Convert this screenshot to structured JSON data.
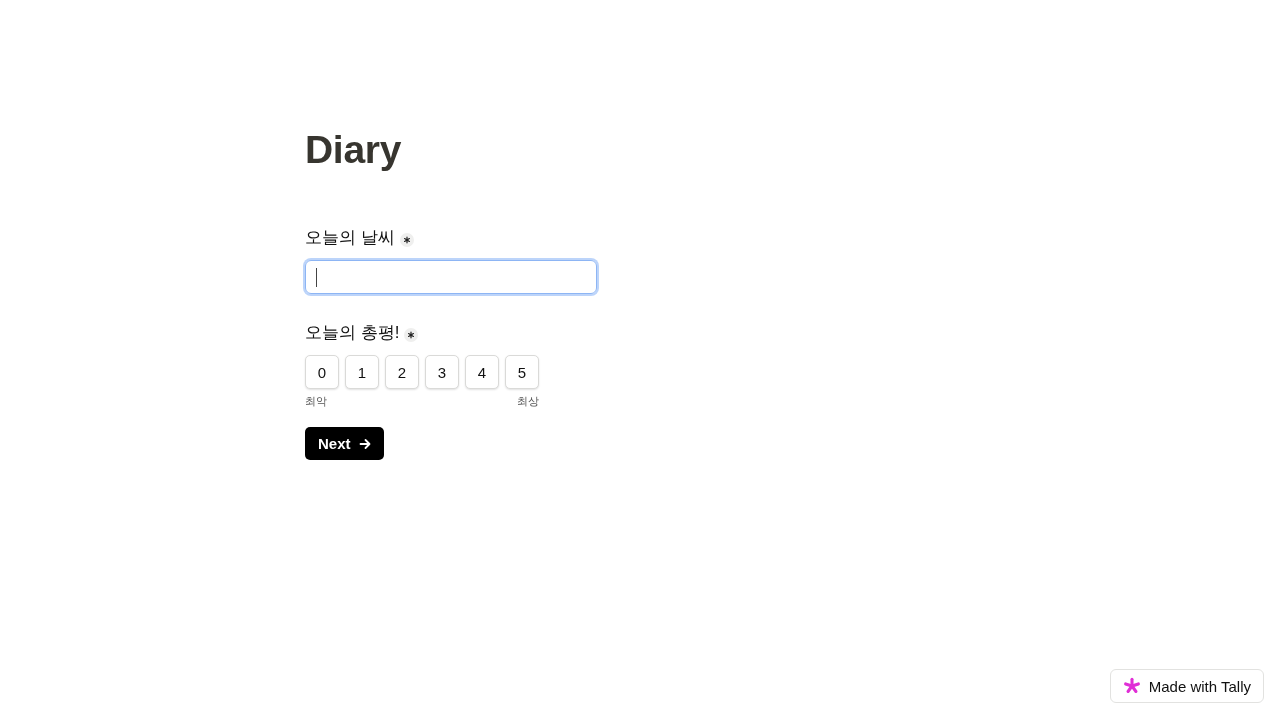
{
  "title": "Diary",
  "questions": [
    {
      "kind": "text",
      "label": "오늘의 날씨",
      "required": true,
      "focused": true
    },
    {
      "kind": "rating",
      "label": "오늘의 총평!",
      "required": true,
      "options": [
        {
          "label": "0",
          "selected": false
        },
        {
          "label": "1",
          "selected": false
        },
        {
          "label": "2",
          "selected": false
        },
        {
          "label": "3",
          "selected": false
        },
        {
          "label": "4",
          "selected": false
        },
        {
          "label": "5",
          "selected": false
        }
      ],
      "min_label": "최악",
      "max_label": "최상"
    }
  ],
  "next_button": {
    "label": "Next"
  },
  "badge": {
    "label": "Made with Tally"
  }
}
